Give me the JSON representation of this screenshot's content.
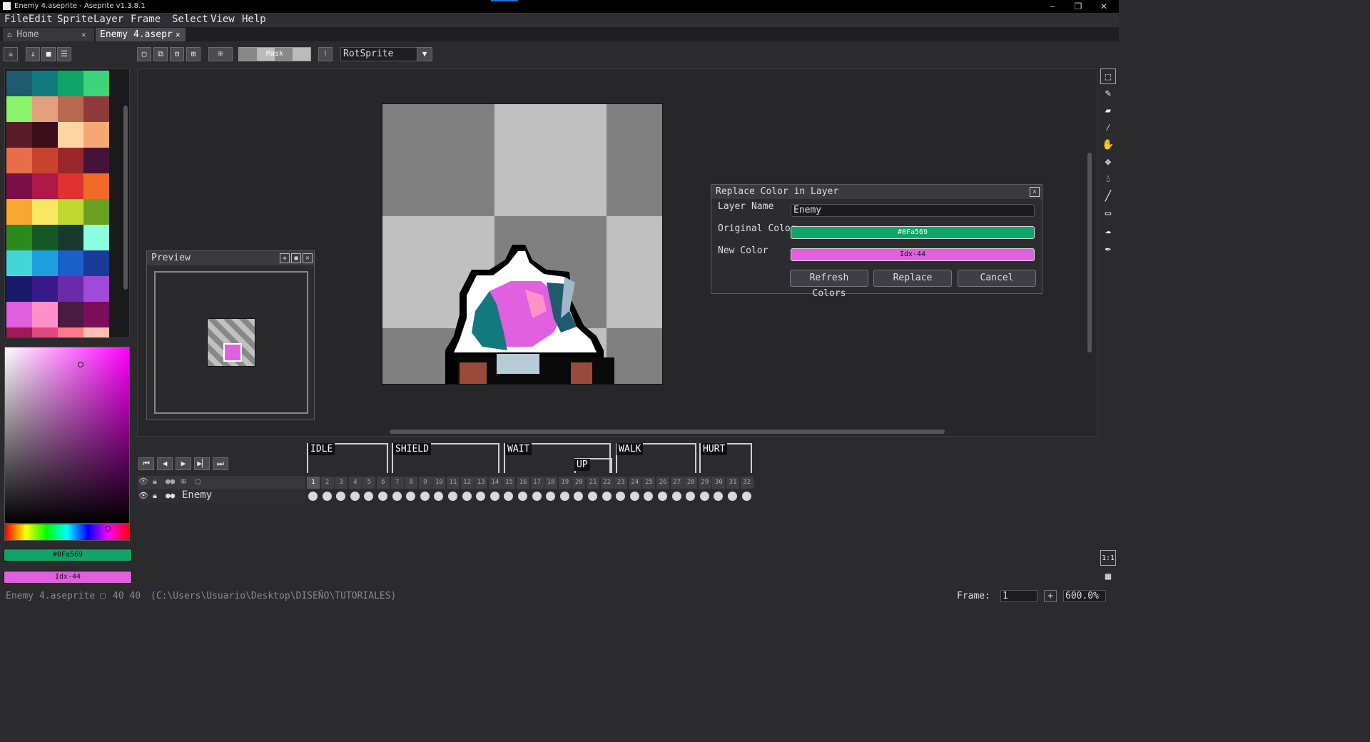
{
  "window": {
    "title": "Enemy 4.aseprite - Aseprite v1.3.8.1",
    "controls": [
      "–",
      "❐",
      "✕"
    ]
  },
  "menu": [
    "File",
    "Edit",
    "Sprite",
    "Layer",
    "Frame",
    "Select",
    "View",
    "Help"
  ],
  "tabs": [
    {
      "label": "Home",
      "icon": "home-icon",
      "active": false
    },
    {
      "label": "Enemy 4.asepr",
      "active": true
    }
  ],
  "toolbar": {
    "mask_label": "Mask",
    "resize_algorithm": "RotSprite"
  },
  "palette": {
    "colors": [
      "#1f5a6e",
      "#127a7e",
      "#0fa569",
      "#3ed57a",
      "#8af56a",
      "#e2a07c",
      "#b86a50",
      "#8f3a3a",
      "#5a1a2a",
      "#3a0f1a",
      "#ffd4a4",
      "#f4a874",
      "#e86e4a",
      "#c8422e",
      "#9a2828",
      "#46123a",
      "#7a0e46",
      "#b0184a",
      "#e03030",
      "#f06a28",
      "#f8a830",
      "#f8e860",
      "#c0d830",
      "#6aa020",
      "#2a8a20",
      "#155a26",
      "#163a2e",
      "#8affe0",
      "#42d6d6",
      "#1ea0e0",
      "#1a60c8",
      "#1a3a9a",
      "#1a1a6a",
      "#3a1a8a",
      "#6a2aaa",
      "#a24ad8",
      "#e060e0",
      "#ff90c8",
      "#4a1a40",
      "#7a0e5a",
      "#a01a5a",
      "#e04a80",
      "#ff7a8a",
      "#ffc0b0"
    ]
  },
  "colors": {
    "foreground": "#0Fa569",
    "foreground_hex": "#0fa569",
    "background": "Idx-44",
    "background_hex": "#e060e0"
  },
  "preview": {
    "title": "Preview"
  },
  "dialog": {
    "title": "Replace Color in Layer",
    "layer_name_label": "Layer Name",
    "layer_name_value": "Enemy",
    "original_color_label": "Original Color",
    "original_color_value": "#0Fa569",
    "new_color_label": "New Color",
    "new_color_value": "Idx-44",
    "refresh_label": "Refresh Colors",
    "replace_label": "Replace",
    "cancel_label": "Cancel"
  },
  "timeline": {
    "tags": [
      {
        "label": "IDLE",
        "color": "#d0d0d0"
      },
      {
        "label": "SHIELD",
        "color": "#d0d0d0"
      },
      {
        "label": "WAIT",
        "color": "#d0d0d0"
      },
      {
        "label": "UP",
        "color": "#d0d0d0"
      },
      {
        "label": "WALK",
        "color": "#d0d0d0"
      },
      {
        "label": "HURT",
        "color": "#d0d0d0"
      }
    ],
    "frames": [
      "1",
      "2",
      "3",
      "4",
      "5",
      "6",
      "7",
      "8",
      "9",
      "10",
      "11",
      "12",
      "13",
      "14",
      "15",
      "16",
      "17",
      "18",
      "19",
      "20",
      "21",
      "22",
      "23",
      "24",
      "25",
      "26",
      "27",
      "28",
      "29",
      "30",
      "31",
      "32"
    ],
    "layer_name": "Enemy"
  },
  "status": {
    "filename": "Enemy 4.aseprite",
    "size": "40 40",
    "path": "(C:\\Users\\Usuario\\Desktop\\DISEÑO\\TUTORIALES)",
    "frame_label": "Frame:",
    "frame_value": "1",
    "zoom": "600.0%"
  }
}
